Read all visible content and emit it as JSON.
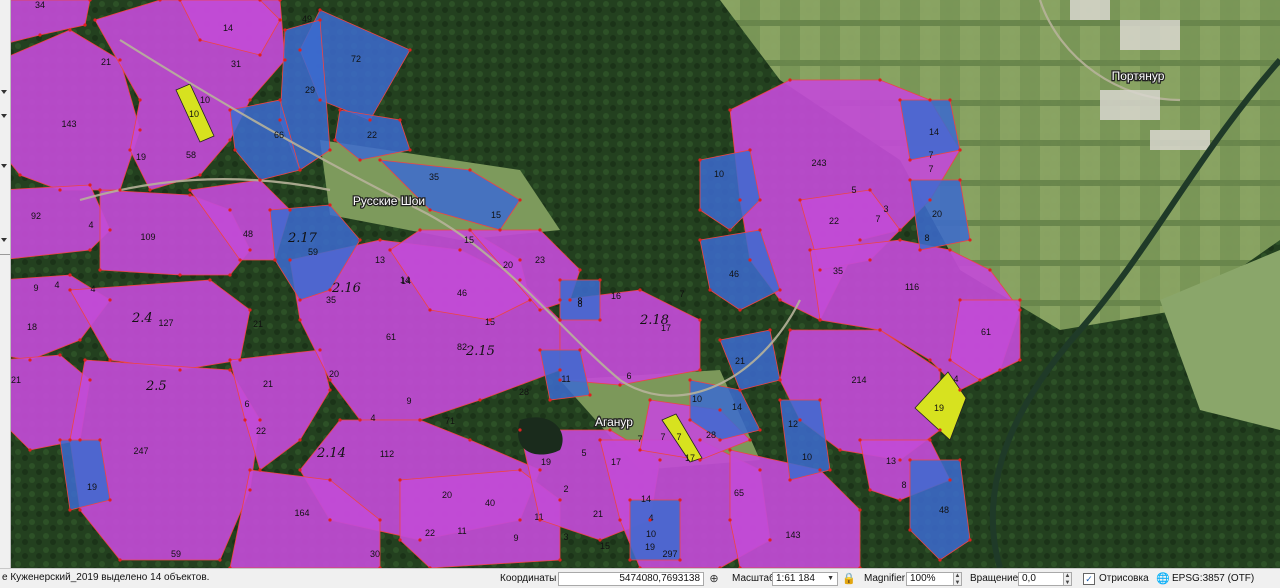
{
  "map": {
    "places": [
      "Русские Шои",
      "Аганур",
      "Портянур"
    ],
    "parcels_magenta": [
      "34",
      "14",
      "31",
      "10",
      "58",
      "19",
      "143",
      "21",
      "92",
      "109",
      "48",
      "59",
      "13",
      "35",
      "21",
      "127",
      "61",
      "20",
      "14",
      "46",
      "82",
      "15",
      "28",
      "71",
      "112",
      "247",
      "22",
      "21",
      "6",
      "9",
      "4",
      "164",
      "30",
      "59",
      "20",
      "40",
      "19",
      "11",
      "22",
      "11",
      "9",
      "2",
      "3",
      "17",
      "5",
      "6",
      "21",
      "15",
      "14",
      "10",
      "17",
      "65",
      "143",
      "7",
      "28",
      "4",
      "297",
      "243",
      "5",
      "3",
      "7",
      "22",
      "35",
      "116",
      "61",
      "214",
      "13",
      "4",
      "23",
      "20",
      "15",
      "14",
      "8",
      "16",
      "17",
      "7",
      "18",
      "9",
      "4",
      "21"
    ],
    "parcels_blue": [
      "49",
      "72",
      "29",
      "22",
      "66",
      "35",
      "15",
      "4",
      "8",
      "10",
      "46",
      "7",
      "21",
      "14",
      "10",
      "12",
      "10",
      "8",
      "48",
      "14",
      "7",
      "7",
      "20",
      "8",
      "11",
      "19",
      "4",
      "19"
    ],
    "parcels_yellow": [
      "10",
      "7",
      "19"
    ],
    "handwritten": [
      "2.17",
      "2.16",
      "2.4",
      "2.5",
      "2.14",
      "2.15",
      "2.18"
    ]
  },
  "statusbar": {
    "message": "е Куженерский_2019 выделено 14 объектов.",
    "coordinates_label": "Координаты",
    "coordinates_value": "5474080,7693138",
    "scale_label": "Масштаб",
    "scale_value": "1:61 184",
    "magnifier_label": "Magnifier",
    "magnifier_value": "100%",
    "rotation_label": "Вращение",
    "rotation_value": "0,0",
    "render_label": "Отрисовка",
    "render_checked": true,
    "crs_label": "EPSG:3857 (OTF)"
  },
  "colors": {
    "magenta": "#c24bd6",
    "blue": "#3c6bd0",
    "yellow": "#d7e21f",
    "vertex": "#e02020"
  }
}
